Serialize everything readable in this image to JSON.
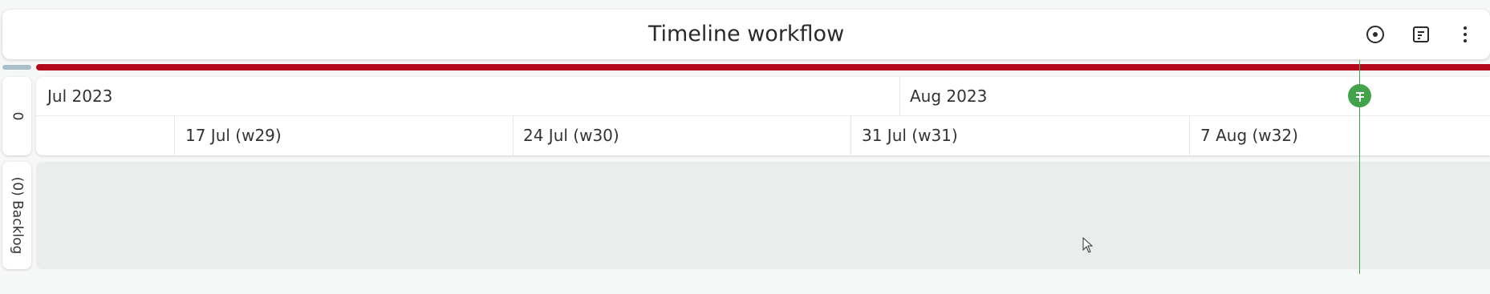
{
  "header": {
    "title": "Timeline workflow"
  },
  "toolbar": {
    "items": [
      {
        "name": "focus-button",
        "icon": "target-icon"
      },
      {
        "name": "notes-button",
        "icon": "note-icon"
      },
      {
        "name": "more-menu-button",
        "icon": "more-vertical-icon"
      }
    ]
  },
  "lanes": [
    {
      "label": "0"
    },
    {
      "label": "(0) Backlog"
    }
  ],
  "timeline": {
    "months": [
      "Jul 2023",
      "Aug 2023"
    ],
    "weeks": [
      "17 Jul (w29)",
      "24 Jul (w30)",
      "31 Jul (w31)",
      "7 Aug (w32)"
    ],
    "today_icon": "today-marker-icon"
  },
  "colors": {
    "progress": "#b5081f",
    "progress_idle": "#a9bfcc",
    "today": "#43a34a",
    "backlog_bg": "#e9edec"
  }
}
